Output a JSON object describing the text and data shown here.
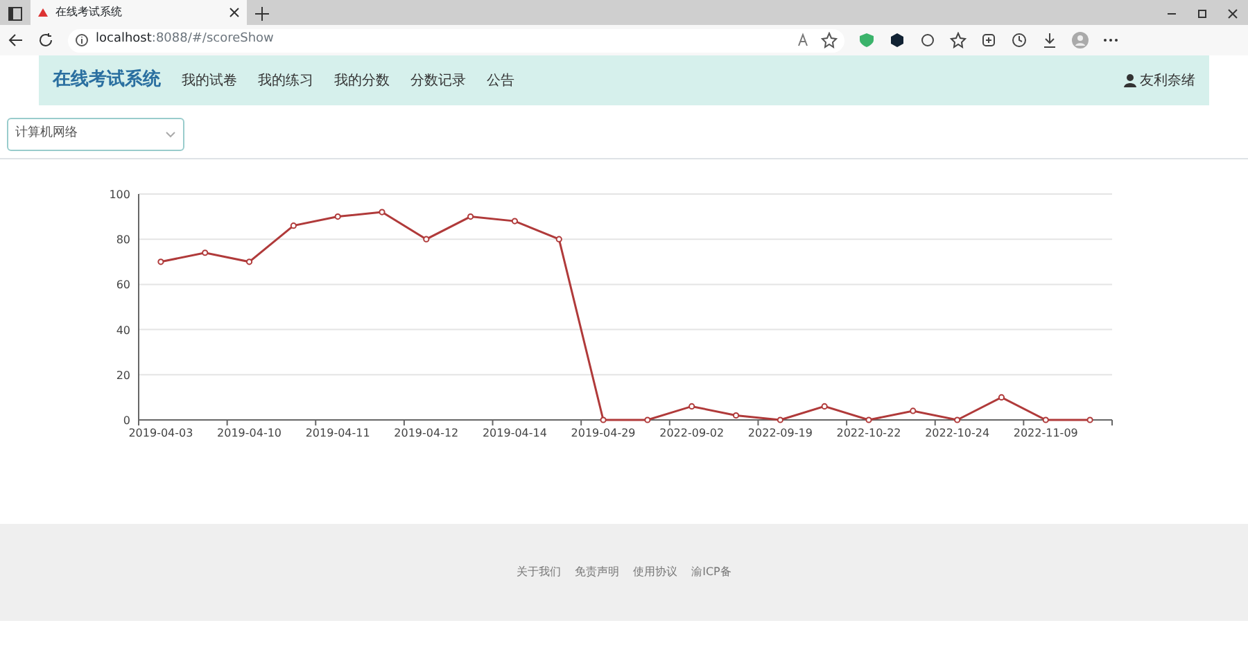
{
  "browser": {
    "tab_title": "在线考试系统",
    "url_host": "localhost",
    "url_rest": ":8088/#/scoreShow"
  },
  "navbar": {
    "brand": "在线考试系统",
    "items": [
      {
        "label": "我的试卷"
      },
      {
        "label": "我的练习"
      },
      {
        "label": "我的分数"
      },
      {
        "label": "分数记录"
      },
      {
        "label": "公告"
      }
    ],
    "user": "友利奈绪"
  },
  "subject_select": {
    "value": "计算机网络"
  },
  "chart": {
    "chart_data": {
      "type": "line",
      "categories": [
        "2019-04-03",
        null,
        "2019-04-10",
        null,
        "2019-04-11",
        null,
        "2019-04-12",
        null,
        "2019-04-14",
        null,
        "2019-04-29",
        null,
        "2022-09-02",
        null,
        "2022-09-19",
        null,
        "2022-10-22",
        null,
        "2022-10-24",
        null,
        "2022-11-09",
        null
      ],
      "grid": true,
      "series": [
        {
          "color": "#b03a3a",
          "marker": true,
          "values": [
            70,
            74,
            70,
            86,
            90,
            92,
            80,
            90,
            88,
            80,
            0,
            0,
            6,
            2,
            0,
            6,
            0,
            4,
            0,
            10,
            0,
            0
          ]
        }
      ],
      "ylim": [
        0,
        100
      ],
      "yticks": [
        0,
        20,
        40,
        60,
        80,
        100
      ]
    }
  },
  "footer": {
    "links": [
      "关于我们",
      "免责声明",
      "使用协议",
      "渝ICP备"
    ]
  }
}
